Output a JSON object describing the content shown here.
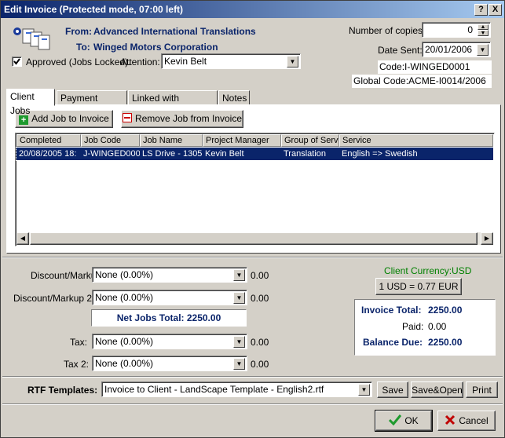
{
  "window": {
    "title": "Edit Invoice (Protected mode, 07:00 left)",
    "help_glyph": "?",
    "close_glyph": "X"
  },
  "header": {
    "from_label": "From:",
    "from_value": "Advanced International Translations",
    "to_label": "To:",
    "to_value": "Winged Motors Corporation",
    "approved_label": "Approved (Jobs Locked).",
    "approved_checked": true,
    "attention_label": "Attention:",
    "attention_value": "Kevin Belt",
    "copies_label": "Number of copies:",
    "copies_value": "0",
    "date_sent_label": "Date Sent:",
    "date_sent_value": "20/01/2006",
    "code": "Code:I-WINGED0001",
    "global_code": "Global Code:ACME-I0014/2006"
  },
  "tabs": [
    "Client Jobs",
    "Payment Method",
    "Linked with Payments",
    "Notes"
  ],
  "jobs": {
    "add_label": "Add Job to Invoice",
    "remove_label": "Remove Job from Invoice",
    "columns": [
      "Completed",
      "Job Code",
      "Job Name",
      "Project Manager",
      "Group of Servi",
      "Service"
    ],
    "rows": [
      [
        "20/08/2005 18:",
        "J-WINGED000",
        "LS Drive - 1305",
        "Kevin Belt",
        "Translation",
        "English => Swedish"
      ]
    ]
  },
  "totals": {
    "discount_label": "Discount/Markup:",
    "discount_value": "None (0.00%)",
    "discount_amount": "0.00",
    "discount2_label": "Discount/Markup 2:",
    "discount2_value": "None (0.00%)",
    "discount2_amount": "0.00",
    "net_jobs_total": "Net Jobs Total: 2250.00",
    "tax_label": "Tax:",
    "tax_value": "None (0.00%)",
    "tax_amount": "0.00",
    "tax2_label": "Tax 2:",
    "tax2_value": "None (0.00%)",
    "tax2_amount": "0.00",
    "client_currency": "Client Currency:USD",
    "rate_button": "1 USD = 0.77 EUR",
    "invoice_total_label": "Invoice Total:",
    "invoice_total": "2250.00",
    "paid_label": "Paid:",
    "paid": "0.00",
    "balance_due_label": "Balance Due:",
    "balance_due": "2250.00"
  },
  "rtf": {
    "label": "RTF Templates:",
    "template": "Invoice to Client - LandScape Template - English2.rtf",
    "save": "Save",
    "save_open": "Save&Open",
    "print": "Print"
  },
  "footer": {
    "ok": "OK",
    "cancel": "Cancel"
  },
  "colors": {
    "selection": "#0a246a",
    "navy_text": "#0a246a",
    "currency_green": "#008000",
    "face": "#d4d0c8"
  }
}
